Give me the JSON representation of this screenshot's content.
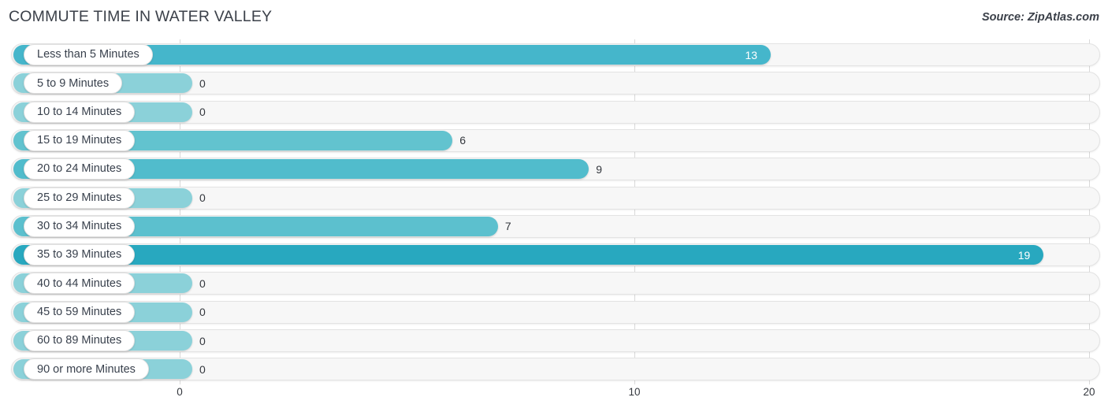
{
  "header": {
    "title": "COMMUTE TIME IN WATER VALLEY",
    "source": "Source: ZipAtlas.com"
  },
  "chart_data": {
    "type": "bar",
    "orientation": "horizontal",
    "title": "COMMUTE TIME IN WATER VALLEY",
    "xlabel": "",
    "ylabel": "",
    "xlim": [
      0,
      20
    ],
    "grid": true,
    "legend": false,
    "xticks": [
      "0",
      "10",
      "20"
    ],
    "xtick_values": [
      0,
      10,
      20
    ],
    "categories": [
      "Less than 5 Minutes",
      "5 to 9 Minutes",
      "10 to 14 Minutes",
      "15 to 19 Minutes",
      "20 to 24 Minutes",
      "25 to 29 Minutes",
      "30 to 34 Minutes",
      "35 to 39 Minutes",
      "40 to 44 Minutes",
      "45 to 59 Minutes",
      "60 to 89 Minutes",
      "90 or more Minutes"
    ],
    "values": [
      13,
      0,
      0,
      6,
      9,
      0,
      7,
      19,
      0,
      0,
      0,
      0
    ],
    "value_labels": [
      "13",
      "0",
      "0",
      "6",
      "9",
      "0",
      "7",
      "19",
      "0",
      "0",
      "0",
      "0"
    ],
    "bar_colors": [
      "#45b6cb",
      "#8bd1d9",
      "#8bd1d9",
      "#62c3cf",
      "#51bccc",
      "#8bd1d9",
      "#5cc0ce",
      "#28a8bf",
      "#8bd1d9",
      "#8bd1d9",
      "#8bd1d9",
      "#8bd1d9"
    ],
    "track_color": "#f7f7f7",
    "gridline_color": "#d9d9d9"
  },
  "axis_label_color": "#33373d"
}
